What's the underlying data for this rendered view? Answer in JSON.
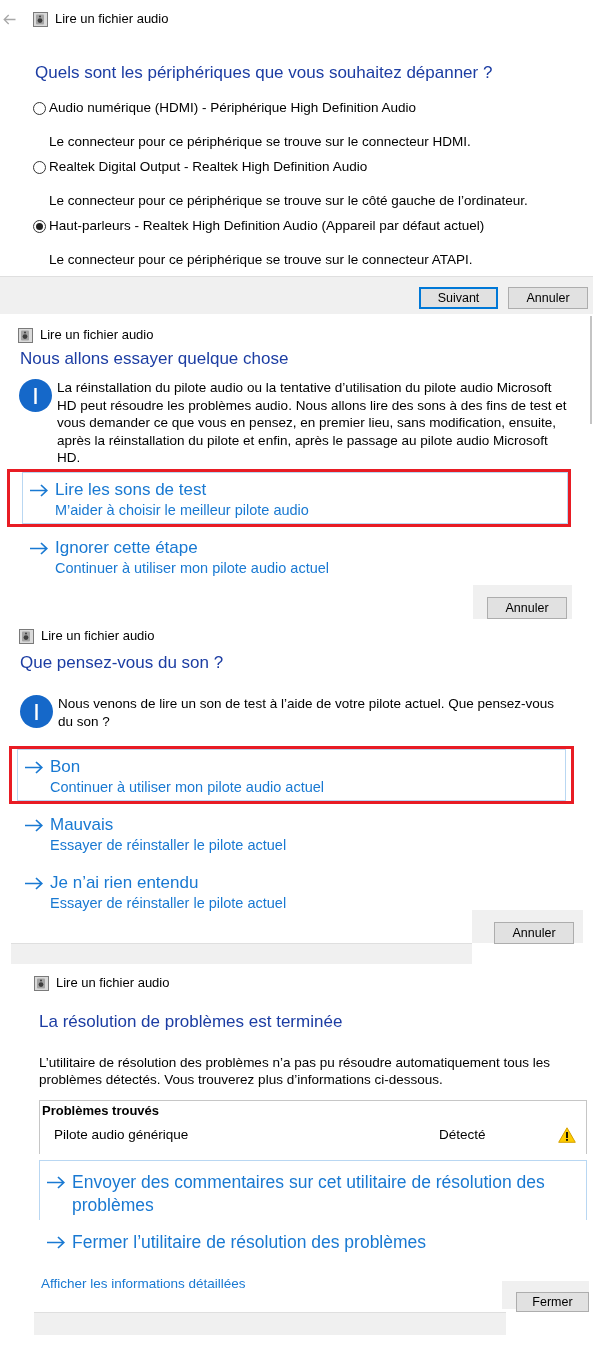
{
  "panels": [
    {
      "kind": "device_select",
      "back_button": {
        "disabled": true
      },
      "title": "Lire un fichier audio",
      "heading": "Quels sont les périphériques que vous souhaitez dépanner ?",
      "devices": [
        {
          "label": "Audio numérique (HDMI) - Périphérique High Definition Audio",
          "description": "Le connecteur pour ce périphérique se trouve sur le connecteur HDMI.",
          "selected": false
        },
        {
          "label": "Realtek Digital Output - Realtek High Definition Audio",
          "description": "Le connecteur pour ce périphérique se trouve sur le côté gauche de l’ordinateur.",
          "selected": false
        },
        {
          "label": "Haut-parleurs - Realtek High Definition Audio (Appareil par défaut actuel)",
          "description": "Le connecteur pour ce périphérique se trouve sur le connecteur ATAPI.",
          "selected": true
        }
      ],
      "buttons": [
        {
          "label": "Suivant",
          "default": true
        },
        {
          "label": "Annuler",
          "default": false
        }
      ]
    },
    {
      "kind": "choice",
      "title": "Lire un fichier audio",
      "heading": "Nous allons essayer quelque chose",
      "info": "La réinstallation du pilote audio ou la tentative d’utilisation du pilote audio Microsoft HD peut résoudre les problèmes audio. Nous allons lire des sons à des fins de test et vous demander ce que vous en pensez, en premier lieu, sans modification, ensuite, après la réinstallation du pilote et enfin, après le passage au pilote audio Microsoft HD.",
      "options": [
        {
          "title": "Lire les sons de test",
          "subtitle": "M’aider à choisir le meilleur pilote audio",
          "focused": true,
          "highlighted": true
        },
        {
          "title": "Ignorer cette étape",
          "subtitle": "Continuer à utiliser mon pilote audio actuel",
          "focused": false,
          "highlighted": false
        }
      ],
      "buttons": [
        {
          "label": "Annuler",
          "default": false
        }
      ]
    },
    {
      "kind": "choice",
      "title": "Lire un fichier audio",
      "heading": "Que pensez-vous du son ?",
      "info": "Nous venons de lire un son de test à l’aide de votre pilote actuel. Que pensez-vous du son ?",
      "options": [
        {
          "title": "Bon",
          "subtitle": "Continuer à utiliser mon pilote audio actuel",
          "focused": true,
          "highlighted": true
        },
        {
          "title": "Mauvais",
          "subtitle": "Essayer de réinstaller le pilote actuel",
          "focused": false,
          "highlighted": false
        },
        {
          "title": "Je n’ai rien entendu",
          "subtitle": "Essayer de réinstaller le pilote actuel",
          "focused": false,
          "highlighted": false
        }
      ],
      "buttons": [
        {
          "label": "Annuler",
          "default": false
        }
      ]
    },
    {
      "kind": "result",
      "title": "Lire un fichier audio",
      "heading": "La résolution de problèmes est terminée",
      "message": "L’utilitaire de résolution des problèmes n’a pas pu résoudre automatiquement tous les problèmes détectés. Vous trouverez plus d’informations ci-dessous.",
      "problems": {
        "heading": "Problèmes trouvés",
        "rows": [
          {
            "name": "Pilote audio générique",
            "status": "Détecté",
            "kind": "warning"
          }
        ]
      },
      "options": [
        {
          "title": "Envoyer des commentaires sur cet utilitaire de résolution des problèmes",
          "focused": true,
          "highlighted": false
        },
        {
          "title": "Fermer l’utilitaire de résolution des problèmes",
          "focused": false,
          "highlighted": false
        }
      ],
      "details_link": "Afficher les informations détaillées",
      "buttons": [
        {
          "label": "Fermer",
          "default": false
        }
      ]
    }
  ]
}
